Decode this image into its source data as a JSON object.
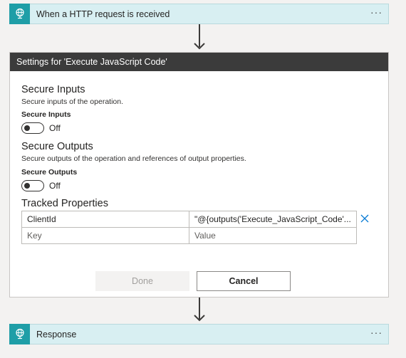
{
  "trigger": {
    "title": "When a HTTP request is received",
    "more_label": "···",
    "icon": "globe-request-icon",
    "accent": "#1f9ea7"
  },
  "settings": {
    "header": "Settings for 'Execute JavaScript Code'",
    "secure_inputs": {
      "title": "Secure Inputs",
      "description": "Secure inputs of the operation.",
      "label": "Secure Inputs",
      "state": "Off"
    },
    "secure_outputs": {
      "title": "Secure Outputs",
      "description": "Secure outputs of the operation and references of output properties.",
      "label": "Secure Outputs",
      "state": "Off"
    },
    "tracked_properties": {
      "title": "Tracked Properties",
      "rows": [
        {
          "key": "ClientId",
          "value": "\"@{outputs('Execute_JavaScript_Code'..."
        }
      ],
      "empty_row": {
        "key_placeholder": "Key",
        "value_placeholder": "Value"
      }
    },
    "buttons": {
      "done": "Done",
      "cancel": "Cancel"
    }
  },
  "response": {
    "title": "Response",
    "more_label": "···",
    "icon": "globe-request-icon"
  }
}
